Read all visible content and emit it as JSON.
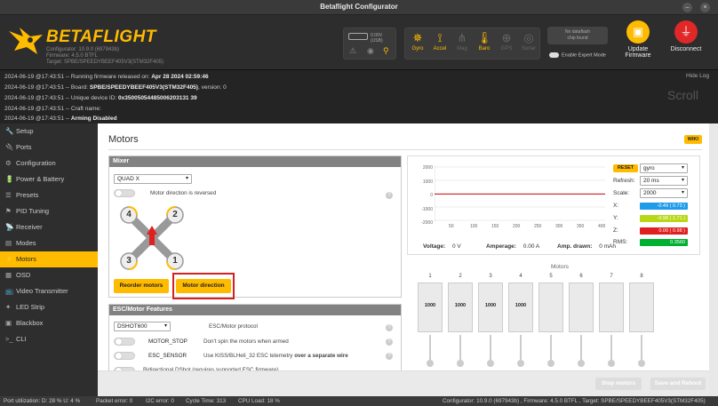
{
  "window": {
    "title": "Betaflight Configurator"
  },
  "header": {
    "brand": "BETAFLIGHT",
    "info": [
      "Configurator: 10.9.0 (697943b)",
      "Firmware: 4.5.0 BTFL",
      "Target: SPBE/SPEEDYBEEF405V3(STM32F405)"
    ],
    "voltage": "0.00V (USB)",
    "sensors": [
      "Gyro",
      "Accel",
      "Mag",
      "Baro",
      "GPS",
      "Sonar"
    ],
    "dataflash": [
      "No dataflash",
      "chip found"
    ],
    "expert_label": "Enable Expert Mode",
    "update_label": [
      "Update",
      "Firmware"
    ],
    "disconnect_label": "Disconnect"
  },
  "log": {
    "hide": "Hide Log",
    "scroll": "Scroll",
    "lines": [
      {
        "prefix": "2024-06-19 @17:43:51 -- Running firmware released on: ",
        "bold": "Apr 28 2024 02:59:46",
        "suffix": ""
      },
      {
        "prefix": "2024-06-19 @17:43:51 -- Board: ",
        "bold": "SPBE/SPEEDYBEEF405V3(STM32F405)",
        "suffix": ", version: 0"
      },
      {
        "prefix": "2024-06-19 @17:43:51 -- Unique device ID: ",
        "bold": "0x35005054485006203131 39",
        "suffix": ""
      },
      {
        "prefix": "2024-06-19 @17:43:51 -- Craft name:",
        "bold": "",
        "suffix": ""
      },
      {
        "prefix": "2024-06-19 @17:43:51 -- ",
        "bold": "Arming Disabled",
        "suffix": ""
      }
    ]
  },
  "nav": [
    "Setup",
    "Ports",
    "Configuration",
    "Power & Battery",
    "Presets",
    "PID Tuning",
    "Receiver",
    "Modes",
    "Motors",
    "OSD",
    "Video Transmitter",
    "LED Strip",
    "Blackbox",
    "CLI"
  ],
  "nav_icons": [
    "🔧",
    "🔌",
    "⚙",
    "🔋",
    "☰",
    "⚑",
    "📡",
    "▤",
    "⚡",
    "▦",
    "📺",
    "✦",
    "▣",
    ">_"
  ],
  "page": {
    "title": "Motors",
    "wiki": "WIKI"
  },
  "mixer": {
    "title": "Mixer",
    "selected": "QUAD X",
    "direction_label": "Motor direction is reversed",
    "motors": [
      "4",
      "2",
      "3",
      "1"
    ],
    "reorder_label": "Reorder motors",
    "direction_button": "Motor direction"
  },
  "esc": {
    "title": "ESC/Motor Features",
    "protocol": "DSHOT600",
    "protocol_label": "ESC/Motor protocol",
    "rows": [
      {
        "name": "MOTOR_STOP",
        "desc": "Don't spin the motors when armed",
        "bold": ""
      },
      {
        "name": "ESC_SENSOR",
        "desc": "Use KISS/BLHeli_32 ESC telemetry ",
        "bold": "over a separate wire"
      }
    ],
    "bidir": "Bidirectional DShot (requires supported ESC firmware)"
  },
  "graph": {
    "yticks": [
      "2000",
      "1000",
      "0",
      "-1000",
      "-2000"
    ],
    "xticks": [
      "50",
      "100",
      "150",
      "200",
      "250",
      "300",
      "350",
      "400"
    ],
    "reset": "RESET",
    "sensor": "gyro",
    "refresh_label": "Refresh:",
    "refresh": "20 ms",
    "scale_label": "Scale:",
    "scale": "2000",
    "x_label": "X:",
    "x_val": "-0.49 ( 0.73 )",
    "y_label": "Y:",
    "y_val": "-0.98 ( 1.71 )",
    "z_label": "Z:",
    "z_val": "0.00 ( 0.98 )",
    "rms_label": "RMS:",
    "rms_val": "0.3560",
    "voltage_label": "Voltage:",
    "voltage": "0 V",
    "amperage_label": "Amperage:",
    "amperage": "0.00 A",
    "power_label": "Amp. drawn:",
    "power": "0 mAh",
    "colors": {
      "x": "#1e9be9",
      "y": "#b8d817",
      "z": "#e02020",
      "rms": "#00b030"
    }
  },
  "motors_panel": {
    "title": "Motors",
    "numbers": [
      "1",
      "2",
      "3",
      "4",
      "5",
      "6",
      "7",
      "8"
    ],
    "values": [
      "1000",
      "1000",
      "1000",
      "1000",
      "",
      "",
      "",
      ""
    ]
  },
  "actions": {
    "stop": "Stop motors",
    "save": "Save and Reboot"
  },
  "status": {
    "port": "Port utilization: D: 28 % U: 4 %",
    "packet": "Packet error: 0",
    "i2c": "I2C error: 0",
    "cycle": "Cycle Time: 313",
    "cpu": "CPU Load: 18 %",
    "version": "Configurator: 10.9.0 (697943b) , Firmware: 4.5.0 BTFL , Target: SPBE/SPEEDYBEEF405V3(STM32F405)"
  }
}
